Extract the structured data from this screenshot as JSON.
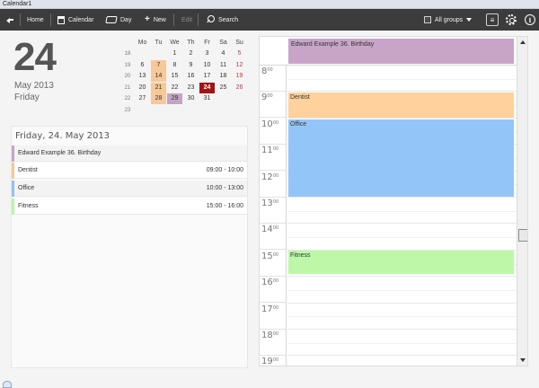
{
  "window": {
    "title": "Calendar1"
  },
  "toolbar": {
    "back_icon": "back-arrow-icon",
    "home": "Home",
    "calendar": "Calendar",
    "day": "Day",
    "new": "New",
    "edit": "Edit",
    "search": "Search",
    "groups": "All groups",
    "info_glyph": "i"
  },
  "header": {
    "day_number": "24",
    "month_year": "May 2013",
    "weekday": "Friday"
  },
  "mini_calendar": {
    "weekday_headers": [
      "Mo",
      "Tu",
      "We",
      "Th",
      "Fr",
      "Sa",
      "Su"
    ],
    "weeks": [
      {
        "week": "18",
        "days": [
          "",
          "",
          "1",
          "2",
          "3",
          "4",
          "5"
        ]
      },
      {
        "week": "19",
        "days": [
          "6",
          "7",
          "8",
          "9",
          "10",
          "11",
          "12"
        ]
      },
      {
        "week": "20",
        "days": [
          "13",
          "14",
          "15",
          "16",
          "17",
          "18",
          "19"
        ]
      },
      {
        "week": "21",
        "days": [
          "20",
          "21",
          "22",
          "23",
          "24",
          "25",
          "26"
        ]
      },
      {
        "week": "22",
        "days": [
          "27",
          "28",
          "29",
          "30",
          "31",
          "",
          ""
        ]
      },
      {
        "week": "23",
        "days": [
          "",
          "",
          "",
          "",
          "",
          "",
          ""
        ]
      }
    ],
    "today": "24",
    "highlight_colors": {
      "today": "#a21313",
      "event": "#f7c89a",
      "birthday": "#c4a4c4"
    }
  },
  "day_list": {
    "heading": "Friday, 24. May 2013",
    "events": [
      {
        "name": "Edward Example  36. Birthday",
        "time": "",
        "color": "#c8a5c8"
      },
      {
        "name": "Dentist",
        "time": "09:00 - 10:00",
        "color": "#f7c89a"
      },
      {
        "name": "Office",
        "time": "10:00 - 13:00",
        "color": "#8ec3f5"
      },
      {
        "name": "Fitness",
        "time": "15:00 - 16:00",
        "color": "#b9f5a6"
      }
    ]
  },
  "day_view": {
    "allday_event": {
      "label": "Edward Example  36. Birthday",
      "color": "#c8a5c8"
    },
    "hours": [
      {
        "h": "8",
        "m": "00"
      },
      {
        "h": "9",
        "m": "00"
      },
      {
        "h": "10",
        "m": "00"
      },
      {
        "h": "11",
        "m": "00"
      },
      {
        "h": "12",
        "m": "00"
      },
      {
        "h": "13",
        "m": "00"
      },
      {
        "h": "14",
        "m": "00"
      },
      {
        "h": "15",
        "m": "00"
      },
      {
        "h": "16",
        "m": "00"
      },
      {
        "h": "17",
        "m": "00"
      },
      {
        "h": "18",
        "m": "00"
      },
      {
        "h": "19",
        "m": "00"
      }
    ],
    "events": [
      {
        "label": "Dentist",
        "color": "#ffd19c"
      },
      {
        "label": "Office",
        "color": "#94c5f8"
      },
      {
        "label": "Fitness",
        "color": "#bdf8a8"
      }
    ]
  }
}
